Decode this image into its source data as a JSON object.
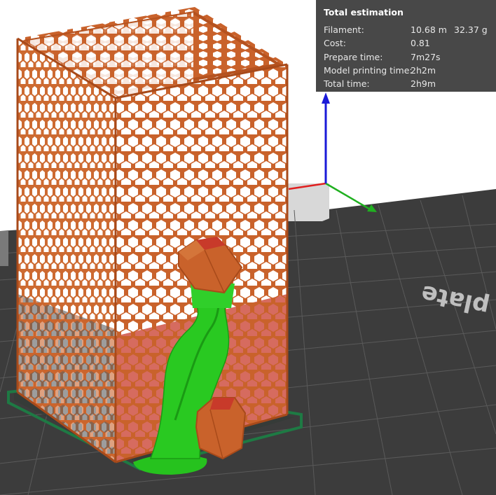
{
  "estimation": {
    "title": "Total estimation",
    "rows": [
      {
        "label": "Filament:",
        "value": "10.68 m",
        "value2": "32.37 g"
      },
      {
        "label": "Cost:",
        "value": "0.81"
      },
      {
        "label": "Prepare time:",
        "value": "7m27s"
      },
      {
        "label": "Model printing time:",
        "value": "2h2m"
      },
      {
        "label": "Total time:",
        "value": "2h9m"
      }
    ]
  },
  "plate": {
    "label_text": "plate"
  },
  "colors": {
    "wall": "#c8642c",
    "wall_light": "#d4753a",
    "wall_dark": "#b5521f",
    "support": "#26c21e",
    "bed": "#3a3a3a",
    "bed_grid": "#505050",
    "brim": "#1e6b3a",
    "axis_x": "#e02020",
    "axis_y": "#20b020",
    "axis_z": "#1a1ad8"
  }
}
